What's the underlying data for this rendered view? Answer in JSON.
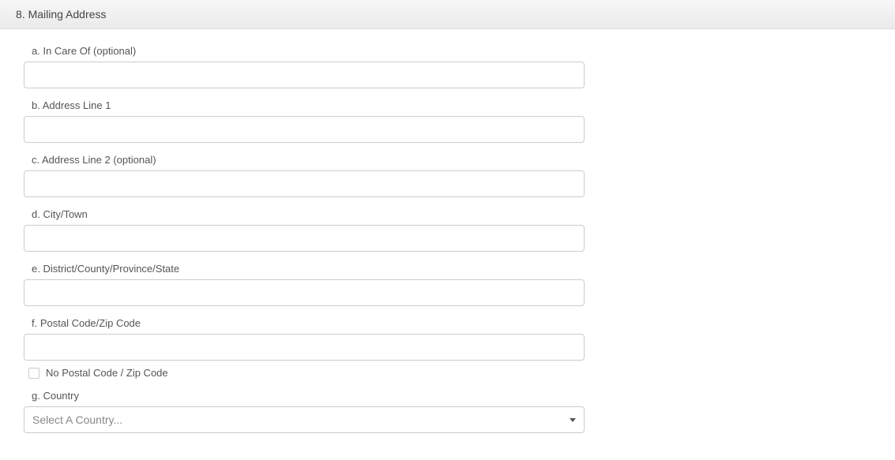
{
  "section": {
    "title": "8. Mailing Address"
  },
  "fields": {
    "in_care_of": {
      "label": "a. In Care Of (optional)",
      "value": ""
    },
    "address1": {
      "label": "b. Address Line 1",
      "value": ""
    },
    "address2": {
      "label": "c. Address Line 2 (optional)",
      "value": ""
    },
    "city": {
      "label": "d. City/Town",
      "value": ""
    },
    "district": {
      "label": "e. District/County/Province/State",
      "value": ""
    },
    "postal": {
      "label": "f. Postal Code/Zip Code",
      "value": ""
    },
    "no_postal": {
      "label": "No Postal Code / Zip Code"
    },
    "country": {
      "label": "g. Country",
      "placeholder": "Select A Country..."
    }
  }
}
